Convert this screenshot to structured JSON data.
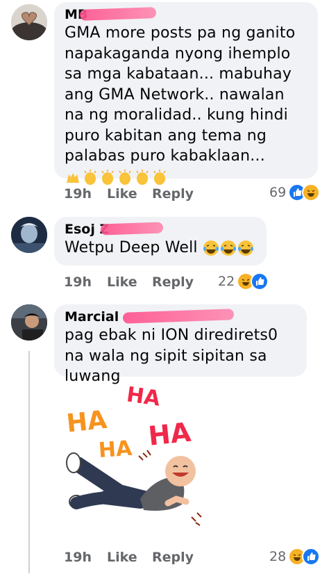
{
  "comments": [
    {
      "author": "MB",
      "text": "GMA more posts pa ng ganito napakaganda nyong ihemplo sa mga kabataan... mabuhay ang GMA Network.. nawalan na ng moralidad.. kung hindi puro kabitan ang tema ng palabas puro kabaklaan...",
      "emojis": [
        "raising-hands",
        "clapping-hands",
        "clapping-hands",
        "clapping-hands",
        "clapping-hands",
        "clapping-hands"
      ],
      "time": "19h",
      "like_label": "Like",
      "reply_label": "Reply",
      "reaction_count": "69",
      "reactions": [
        "like",
        "haha"
      ]
    },
    {
      "author": "Esoj Z",
      "text": "Wetpu Deep Well",
      "emojis": [
        "tears-of-joy",
        "tears-of-joy",
        "tears-of-joy"
      ],
      "time": "19h",
      "like_label": "Like",
      "reply_label": "Reply",
      "reaction_count": "22",
      "reactions": [
        "haha",
        "like"
      ]
    },
    {
      "author": "Marcial",
      "text": "pag ebak ni ION diredirets0 na wala ng sipit sipitan sa luwang",
      "sticker_words": [
        "HA",
        "HA",
        "HA",
        "HA"
      ],
      "time": "19h",
      "like_label": "Like",
      "reply_label": "Reply",
      "reaction_count": "28",
      "reactions": [
        "haha",
        "like"
      ]
    }
  ],
  "colors": {
    "bubble": "#f0f2f5",
    "meta": "#65676b",
    "like_blue": "#1877f2",
    "haha_yellow": "#f7b125",
    "sticker_red": "#f0284a",
    "sticker_orange": "#f7931e"
  }
}
